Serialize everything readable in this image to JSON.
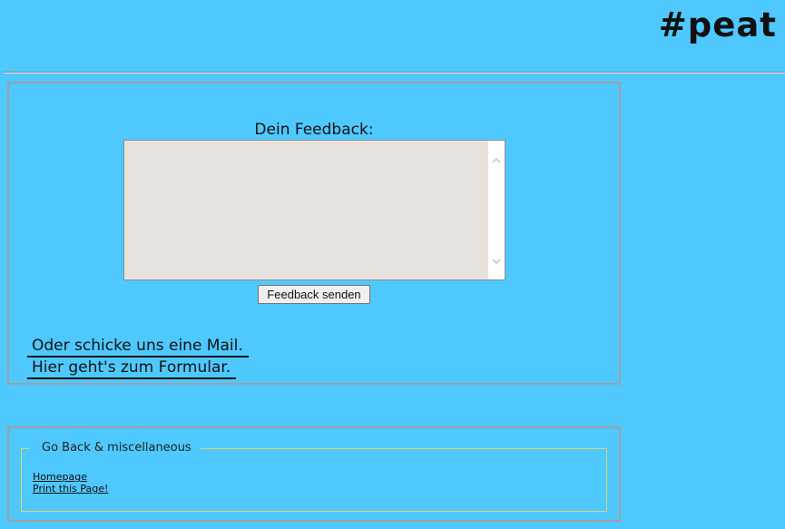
{
  "header": {
    "logo": "#peat"
  },
  "feedback": {
    "label": "Dein Feedback:",
    "textarea_value": "",
    "send_button": "Feedback senden",
    "mail_link": "Oder schicke uns eine Mail.",
    "form_link": "Hier geht's zum Formular."
  },
  "misc": {
    "legend": "Go Back & miscellaneous",
    "links": [
      "Homepage",
      "Print this Page!"
    ]
  },
  "colors": {
    "background": "#4fc8fd",
    "textarea_bg": "#e8e2df",
    "panel_border": "#a0a0a0",
    "fieldset_border": "#d8d66a"
  }
}
